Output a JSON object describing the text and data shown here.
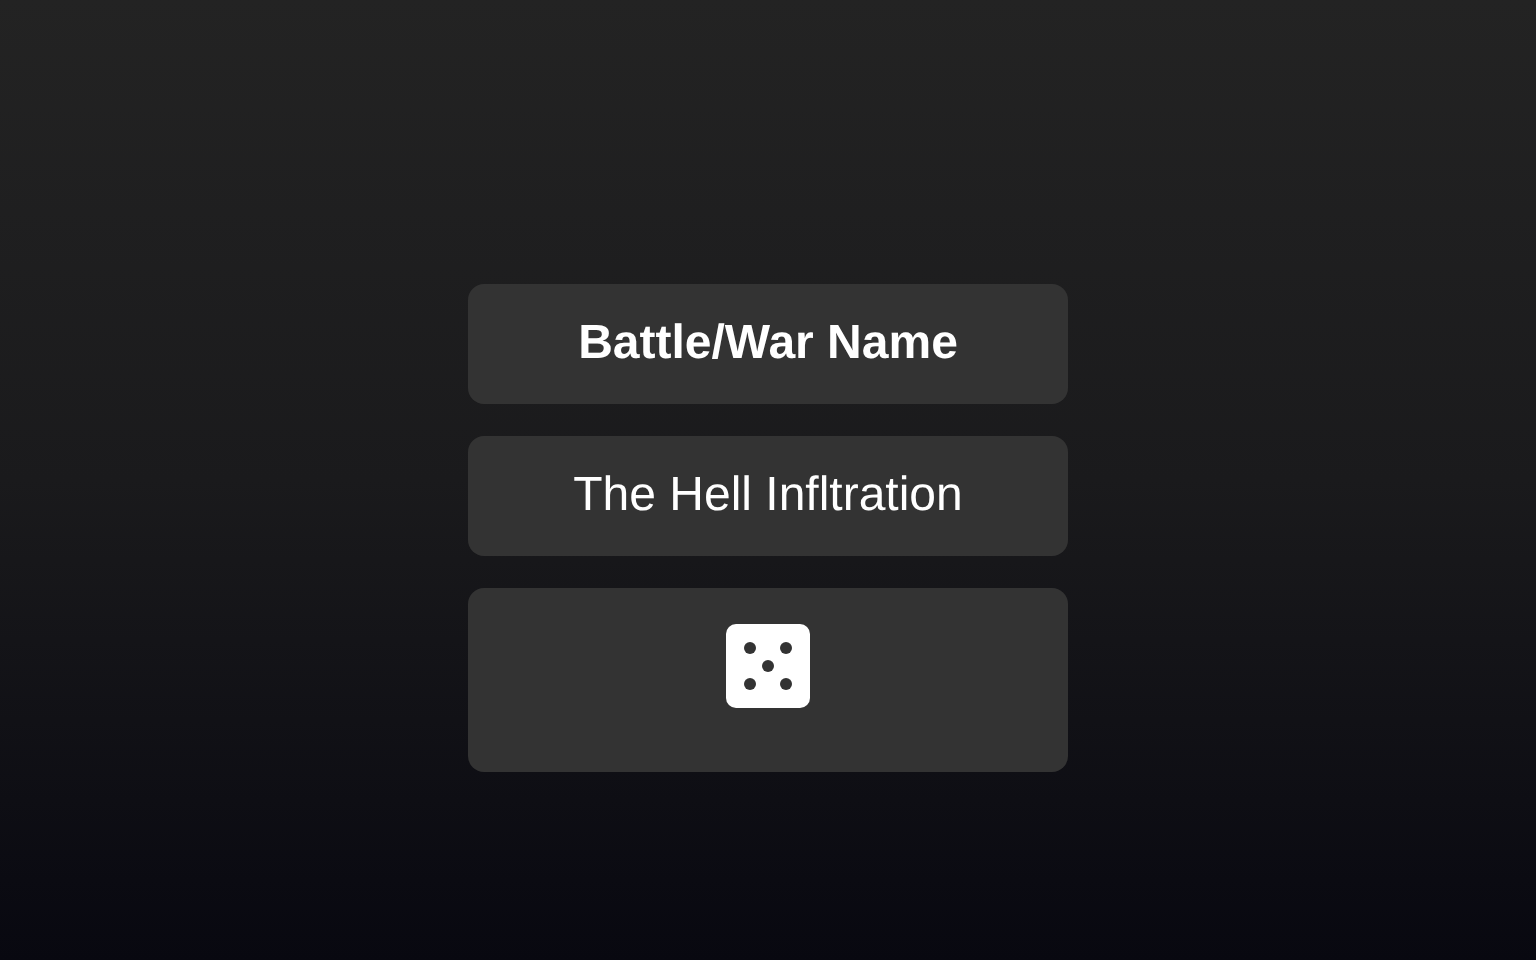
{
  "heading": "Battle/War Name",
  "result": "The Hell Infltration",
  "roll_button": {
    "kind": "dice"
  }
}
